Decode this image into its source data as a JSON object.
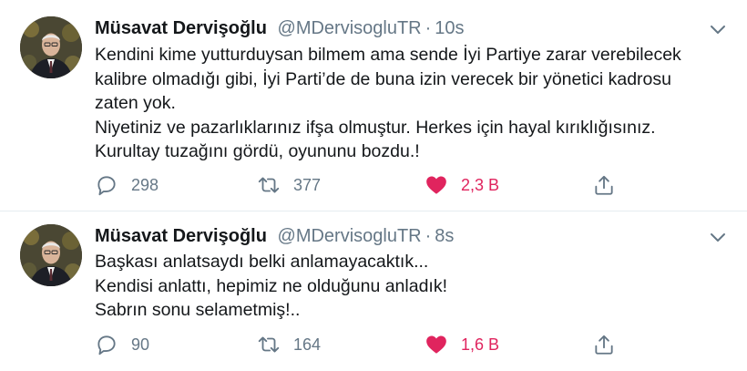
{
  "tweets": [
    {
      "author_name": "Müsavat Dervişoğlu",
      "handle": "@MDervisogluTR",
      "separator": "·",
      "time": "10s",
      "lines": [
        "Kendini kime yutturduysan bilmem ama sende İyi Partiye zarar verebilecek",
        "kalibre olmadığı gibi, İyi Parti’de de buna izin verecek bir yönetici kadrosu",
        "zaten yok.",
        "Niyetiniz ve pazarlıklarınız ifşa olmuştur. Herkes için hayal kırıklığısınız.",
        "Kurultay tuzağını gördü, oyununu bozdu.!"
      ],
      "replies": "298",
      "retweets": "377",
      "likes": "2,3 B",
      "liked": true
    },
    {
      "author_name": "Müsavat Dervişoğlu",
      "handle": "@MDervisogluTR",
      "separator": "·",
      "time": "8s",
      "lines": [
        "Başkası anlatsaydı belki anlamayacaktık...",
        "Kendisi anlattı, hepimiz ne olduğunu anladık!",
        "Sabrın sonu selametmiş!.."
      ],
      "replies": "90",
      "retweets": "164",
      "likes": "1,6 B",
      "liked": true
    }
  ],
  "colors": {
    "text": "#14171a",
    "secondary": "#657786",
    "like_active": "#e0245e",
    "divider": "#e6ecf0"
  },
  "icons": {
    "caret": "chevron-down-icon",
    "reply": "reply-icon",
    "retweet": "retweet-icon",
    "like": "heart-icon",
    "share": "share-icon"
  }
}
